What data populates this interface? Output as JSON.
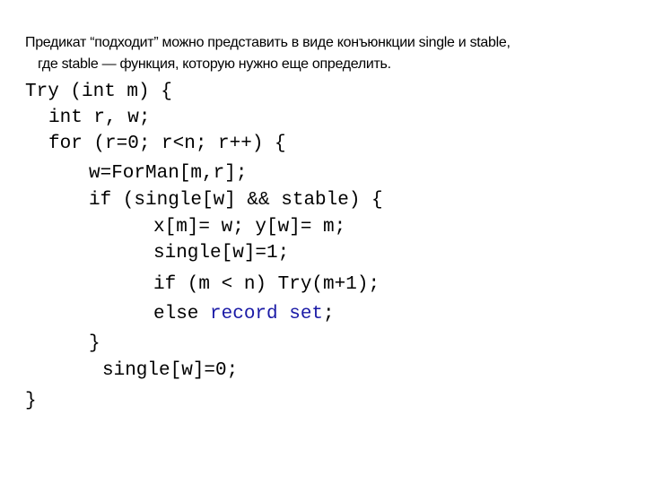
{
  "intro": {
    "line1": "Предикат “подходит” можно представить в виде конъюнкции single и stable,",
    "line2": "где stable — функция, которую нужно еще определить."
  },
  "code": {
    "lines": [
      "Try (int m) {",
      "int r, w;",
      "for (r=0; r<n; r++) {",
      "w=ForMan[m,r];",
      "if (single[w] && stable) {",
      "x[m]= w; y[w]= m;",
      "single[w]=1;",
      "if (m < n) Try(m+1);",
      "else ",
      "}",
      "single[w]=0;",
      "}"
    ],
    "highlight": "record set",
    "highlight_suffix": ";",
    "highlight_color": "#1a1aa6"
  }
}
